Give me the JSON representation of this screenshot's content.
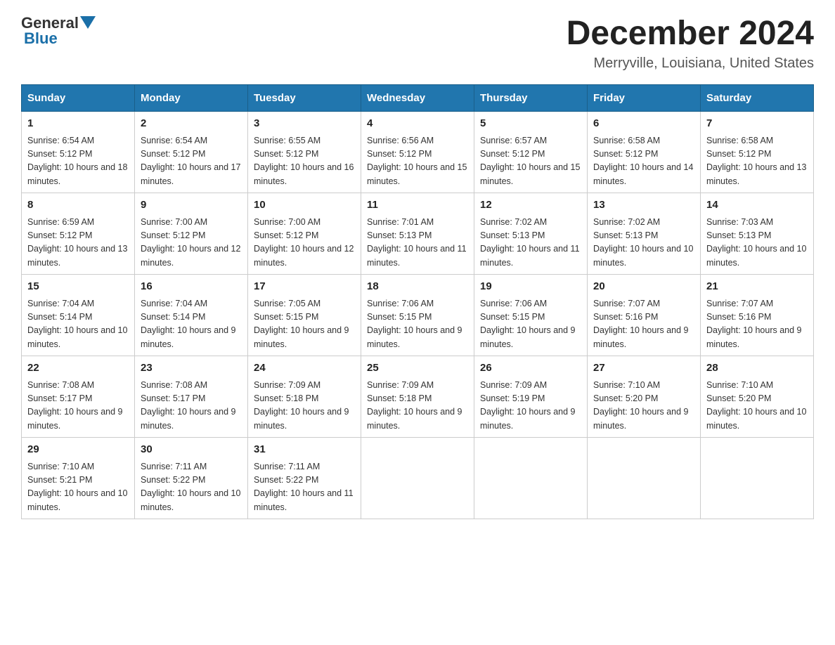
{
  "header": {
    "logo_general": "General",
    "logo_blue": "Blue",
    "title": "December 2024",
    "subtitle": "Merryville, Louisiana, United States"
  },
  "days_of_week": [
    "Sunday",
    "Monday",
    "Tuesday",
    "Wednesday",
    "Thursday",
    "Friday",
    "Saturday"
  ],
  "weeks": [
    [
      {
        "day": "1",
        "sunrise": "6:54 AM",
        "sunset": "5:12 PM",
        "daylight": "10 hours and 18 minutes."
      },
      {
        "day": "2",
        "sunrise": "6:54 AM",
        "sunset": "5:12 PM",
        "daylight": "10 hours and 17 minutes."
      },
      {
        "day": "3",
        "sunrise": "6:55 AM",
        "sunset": "5:12 PM",
        "daylight": "10 hours and 16 minutes."
      },
      {
        "day": "4",
        "sunrise": "6:56 AM",
        "sunset": "5:12 PM",
        "daylight": "10 hours and 15 minutes."
      },
      {
        "day": "5",
        "sunrise": "6:57 AM",
        "sunset": "5:12 PM",
        "daylight": "10 hours and 15 minutes."
      },
      {
        "day": "6",
        "sunrise": "6:58 AM",
        "sunset": "5:12 PM",
        "daylight": "10 hours and 14 minutes."
      },
      {
        "day": "7",
        "sunrise": "6:58 AM",
        "sunset": "5:12 PM",
        "daylight": "10 hours and 13 minutes."
      }
    ],
    [
      {
        "day": "8",
        "sunrise": "6:59 AM",
        "sunset": "5:12 PM",
        "daylight": "10 hours and 13 minutes."
      },
      {
        "day": "9",
        "sunrise": "7:00 AM",
        "sunset": "5:12 PM",
        "daylight": "10 hours and 12 minutes."
      },
      {
        "day": "10",
        "sunrise": "7:00 AM",
        "sunset": "5:12 PM",
        "daylight": "10 hours and 12 minutes."
      },
      {
        "day": "11",
        "sunrise": "7:01 AM",
        "sunset": "5:13 PM",
        "daylight": "10 hours and 11 minutes."
      },
      {
        "day": "12",
        "sunrise": "7:02 AM",
        "sunset": "5:13 PM",
        "daylight": "10 hours and 11 minutes."
      },
      {
        "day": "13",
        "sunrise": "7:02 AM",
        "sunset": "5:13 PM",
        "daylight": "10 hours and 10 minutes."
      },
      {
        "day": "14",
        "sunrise": "7:03 AM",
        "sunset": "5:13 PM",
        "daylight": "10 hours and 10 minutes."
      }
    ],
    [
      {
        "day": "15",
        "sunrise": "7:04 AM",
        "sunset": "5:14 PM",
        "daylight": "10 hours and 10 minutes."
      },
      {
        "day": "16",
        "sunrise": "7:04 AM",
        "sunset": "5:14 PM",
        "daylight": "10 hours and 9 minutes."
      },
      {
        "day": "17",
        "sunrise": "7:05 AM",
        "sunset": "5:15 PM",
        "daylight": "10 hours and 9 minutes."
      },
      {
        "day": "18",
        "sunrise": "7:06 AM",
        "sunset": "5:15 PM",
        "daylight": "10 hours and 9 minutes."
      },
      {
        "day": "19",
        "sunrise": "7:06 AM",
        "sunset": "5:15 PM",
        "daylight": "10 hours and 9 minutes."
      },
      {
        "day": "20",
        "sunrise": "7:07 AM",
        "sunset": "5:16 PM",
        "daylight": "10 hours and 9 minutes."
      },
      {
        "day": "21",
        "sunrise": "7:07 AM",
        "sunset": "5:16 PM",
        "daylight": "10 hours and 9 minutes."
      }
    ],
    [
      {
        "day": "22",
        "sunrise": "7:08 AM",
        "sunset": "5:17 PM",
        "daylight": "10 hours and 9 minutes."
      },
      {
        "day": "23",
        "sunrise": "7:08 AM",
        "sunset": "5:17 PM",
        "daylight": "10 hours and 9 minutes."
      },
      {
        "day": "24",
        "sunrise": "7:09 AM",
        "sunset": "5:18 PM",
        "daylight": "10 hours and 9 minutes."
      },
      {
        "day": "25",
        "sunrise": "7:09 AM",
        "sunset": "5:18 PM",
        "daylight": "10 hours and 9 minutes."
      },
      {
        "day": "26",
        "sunrise": "7:09 AM",
        "sunset": "5:19 PM",
        "daylight": "10 hours and 9 minutes."
      },
      {
        "day": "27",
        "sunrise": "7:10 AM",
        "sunset": "5:20 PM",
        "daylight": "10 hours and 9 minutes."
      },
      {
        "day": "28",
        "sunrise": "7:10 AM",
        "sunset": "5:20 PM",
        "daylight": "10 hours and 10 minutes."
      }
    ],
    [
      {
        "day": "29",
        "sunrise": "7:10 AM",
        "sunset": "5:21 PM",
        "daylight": "10 hours and 10 minutes."
      },
      {
        "day": "30",
        "sunrise": "7:11 AM",
        "sunset": "5:22 PM",
        "daylight": "10 hours and 10 minutes."
      },
      {
        "day": "31",
        "sunrise": "7:11 AM",
        "sunset": "5:22 PM",
        "daylight": "10 hours and 11 minutes."
      },
      null,
      null,
      null,
      null
    ]
  ],
  "labels": {
    "sunrise_prefix": "Sunrise: ",
    "sunset_prefix": "Sunset: ",
    "daylight_prefix": "Daylight: "
  }
}
